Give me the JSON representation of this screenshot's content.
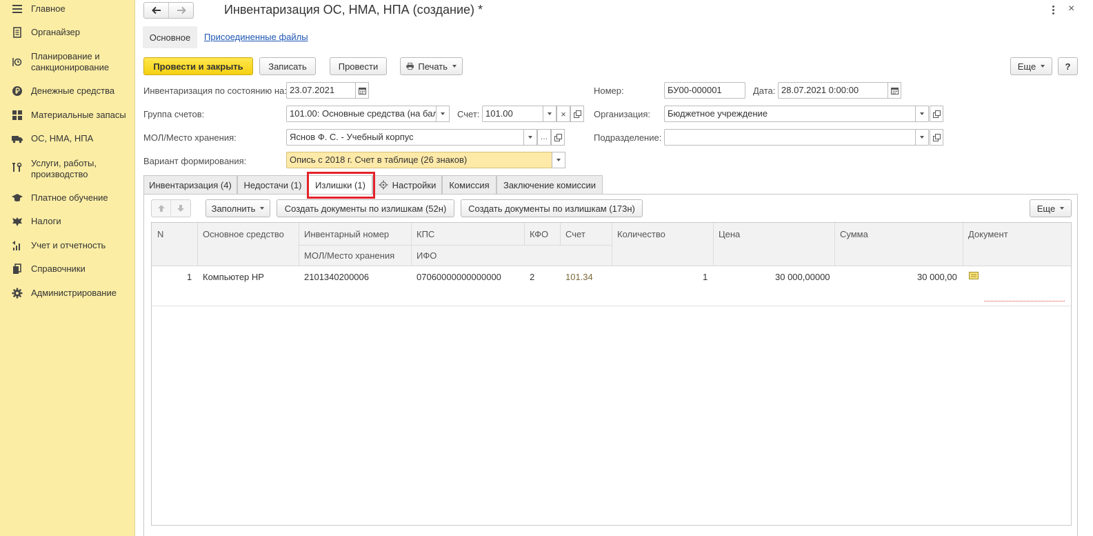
{
  "sidebar": {
    "items": [
      {
        "label": "Главное",
        "icon": "hamburger-icon"
      },
      {
        "label": "Органайзер",
        "icon": "notebook-icon"
      },
      {
        "label": "Планирование и санкционирование",
        "icon": "planning-icon"
      },
      {
        "label": "Денежные средства",
        "icon": "ruble-coin-icon"
      },
      {
        "label": "Материальные запасы",
        "icon": "grid-icon"
      },
      {
        "label": "ОС, НМА, НПА",
        "icon": "truck-icon"
      },
      {
        "label": "Услуги, работы, производство",
        "icon": "tools-icon"
      },
      {
        "label": "Платное обучение",
        "icon": "graduation-cap-icon"
      },
      {
        "label": "Налоги",
        "icon": "eagle-emblem-icon"
      },
      {
        "label": "Учет и отчетность",
        "icon": "chart-icon"
      },
      {
        "label": "Справочники",
        "icon": "books-icon"
      },
      {
        "label": "Администрирование",
        "icon": "gear-icon"
      }
    ]
  },
  "header": {
    "title": "Инвентаризация ОС, НМА, НПА (создание) *",
    "tabs": [
      "Основное",
      "Присоединенные файлы"
    ]
  },
  "toolbar": {
    "post_close": "Провести и закрыть",
    "save": "Записать",
    "post": "Провести",
    "print": "Печать",
    "more": "Еще",
    "help": "?"
  },
  "form": {
    "inv_date_label": "Инвентаризация по состоянию на:",
    "inv_date": "23.07.2021",
    "account_group_label": "Группа счетов:",
    "account_group": "101.00: Основные средства (на бал",
    "account_label": "Счет:",
    "account": "101.00",
    "mol_label": "МОЛ/Место хранения:",
    "mol": "Яснов Ф. С. - Учебный корпус",
    "variant_label": "Вариант формирования:",
    "variant": "Опись с 2018 г. Счет в таблице (26 знаков)",
    "number_label": "Номер:",
    "number": "БУ00-000001",
    "date_label": "Дата:",
    "date": "28.07.2021  0:00:00",
    "org_label": "Организация:",
    "org": "Бюджетное учреждение",
    "dept_label": "Подразделение:",
    "dept": ""
  },
  "tabs": [
    "Инвентаризация (4)",
    "Недостачи (1)",
    "Излишки (1)",
    "Настройки",
    "Комиссия",
    "Заключение комиссии"
  ],
  "table_toolbar": {
    "fill": "Заполнить",
    "create52": "Создать документы по излишкам (52н)",
    "create173": "Создать документы по излишкам (173н)",
    "more": "Еще"
  },
  "table": {
    "headers": {
      "n": "N",
      "asset": "Основное средство",
      "inv_number": "Инвентарный номер",
      "mol": "МОЛ/Место хранения",
      "kps": "КПС",
      "ifo": "ИФО",
      "kfo": "КФО",
      "account": "Счет",
      "qty": "Количество",
      "price": "Цена",
      "sum": "Сумма",
      "doc": "Документ"
    },
    "rows": [
      {
        "n": "1",
        "asset": "Компьютер HP",
        "inv_number": "2101340200006",
        "kps": "07060000000000000",
        "kfo": "2",
        "account": "101.34",
        "qty": "1",
        "price": "30 000,00000",
        "sum": "30 000,00"
      }
    ]
  },
  "colors": {
    "sidebar_bg": "#fbeda4",
    "primary_button": "#f5cf12",
    "highlight_border": "#e3232a",
    "variant_field_bg": "#fde9a8"
  }
}
